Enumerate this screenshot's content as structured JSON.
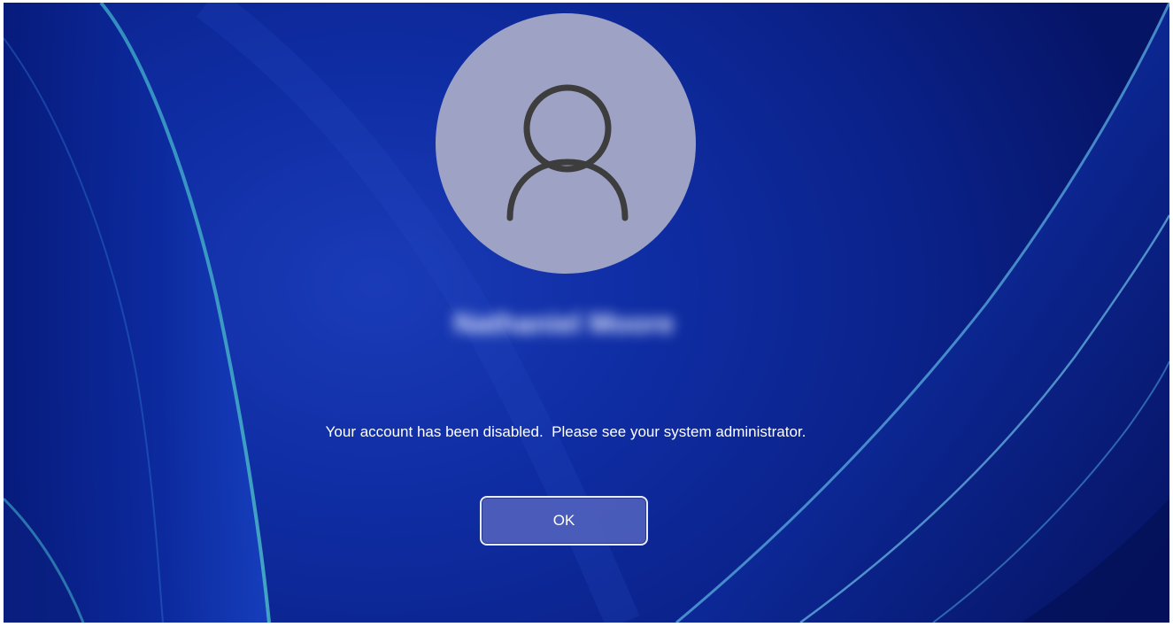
{
  "lock_screen": {
    "user_name": "Nathaniel Moore",
    "message": "Your account has been disabled.  Please see your system administrator.",
    "ok_label": "OK"
  },
  "colors": {
    "background_deep": "#0a2188",
    "background_light": "#1a3bb8",
    "avatar_circle": "#9ea3c6",
    "avatar_glyph": "#3d3d3d",
    "button_fill": "#5564be",
    "button_border": "#e8ecff",
    "text": "#ffffff"
  },
  "icons": {
    "avatar": "user-silhouette-icon"
  }
}
